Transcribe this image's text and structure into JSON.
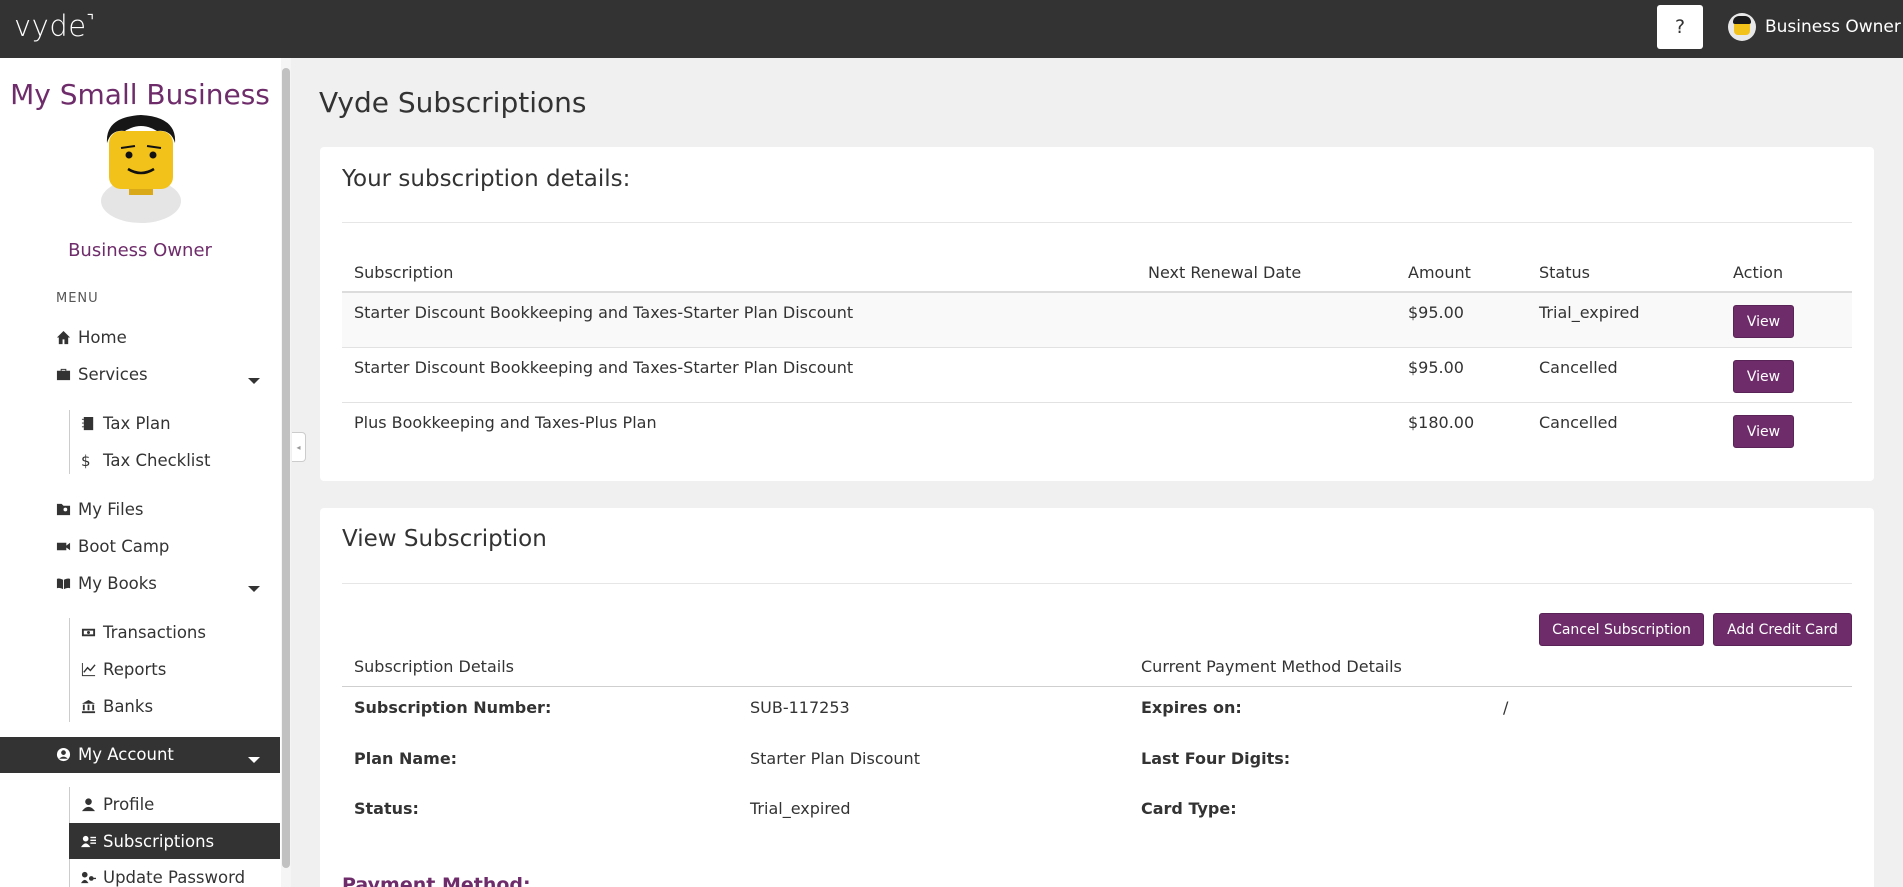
{
  "topbar": {
    "logo": "vyde",
    "help_label": "?",
    "user_name": "Business Owner"
  },
  "sidebar": {
    "business_name": "My Small Business",
    "role": "Business Owner",
    "menu_heading": "MENU",
    "items": {
      "home": "Home",
      "services": "Services",
      "tax_plan": "Tax Plan",
      "tax_checklist": "Tax Checklist",
      "my_files": "My Files",
      "boot_camp": "Boot Camp",
      "my_books": "My Books",
      "transactions": "Transactions",
      "reports": "Reports",
      "banks": "Banks",
      "my_account": "My Account",
      "profile": "Profile",
      "subscriptions": "Subscriptions",
      "update_password": "Update Password"
    }
  },
  "page_title": "Vyde Subscriptions",
  "subscriptions_card": {
    "title": "Your subscription details:",
    "columns": [
      "Subscription",
      "Next Renewal Date",
      "Amount",
      "Status",
      "Action"
    ],
    "rows": [
      {
        "subscription": "Starter Discount Bookkeeping and Taxes-Starter Plan Discount",
        "next_renewal": "",
        "amount": "$95.00",
        "status": "Trial_expired",
        "action": "View"
      },
      {
        "subscription": "Starter Discount Bookkeeping and Taxes-Starter Plan Discount",
        "next_renewal": "",
        "amount": "$95.00",
        "status": "Cancelled",
        "action": "View"
      },
      {
        "subscription": "Plus Bookkeeping and Taxes-Plus Plan",
        "next_renewal": "",
        "amount": "$180.00",
        "status": "Cancelled",
        "action": "View"
      }
    ]
  },
  "view_card": {
    "title": "View Subscription",
    "cancel_label": "Cancel Subscription",
    "add_card_label": "Add Credit Card",
    "details_heading": "Subscription Details",
    "payment_heading": "Current Payment Method Details",
    "details": {
      "number_label": "Subscription Number:",
      "number_value": "SUB-117253",
      "plan_label": "Plan Name:",
      "plan_value": "Starter Plan Discount",
      "status_label": "Status:",
      "status_value": "Trial_expired"
    },
    "payment": {
      "expires_label": "Expires on:",
      "expires_value": "/",
      "last_four_label": "Last Four Digits:",
      "last_four_value": "",
      "card_type_label": "Card Type:",
      "card_type_value": ""
    },
    "payment_method_heading": "Payment Method:"
  },
  "colors": {
    "brand": "#6f2c6b",
    "topbar": "#333333",
    "page_bg": "#f0f0f0"
  },
  "icons": {
    "home": "home-icon",
    "services": "briefcase-icon",
    "tax_plan": "notebook-icon",
    "tax_checklist": "dollar-icon",
    "my_files": "folder-user-icon",
    "boot_camp": "video-camera-icon",
    "my_books": "book-open-icon",
    "transactions": "money-bill-icon",
    "reports": "line-chart-icon",
    "banks": "bank-icon",
    "my_account": "user-circle-icon",
    "profile": "user-icon",
    "subscriptions": "user-list-icon",
    "update_password": "user-key-icon"
  }
}
